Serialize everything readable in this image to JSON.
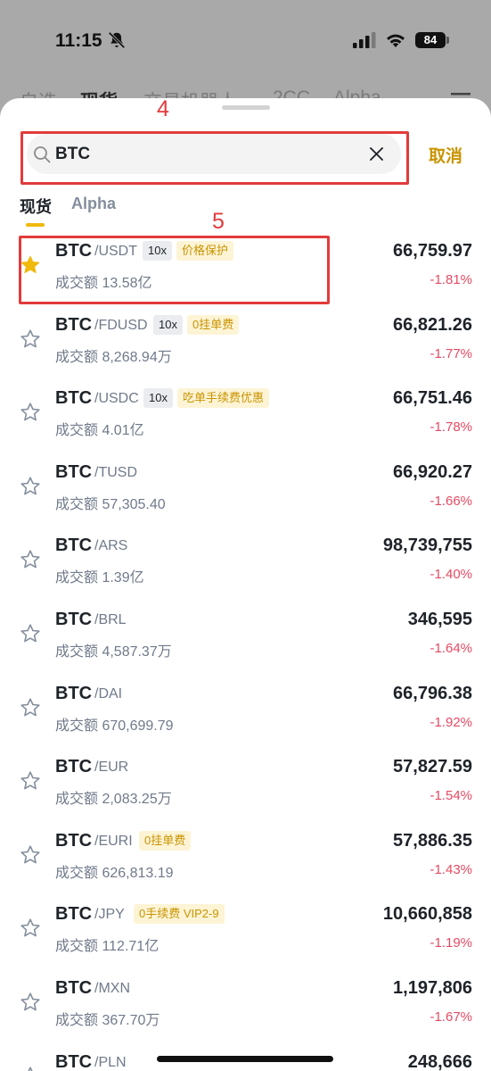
{
  "status_bar": {
    "time": "11:15",
    "battery": "84"
  },
  "background_tabs": [
    "自选",
    "现货",
    "交易机器人",
    "2CC",
    "Alpha"
  ],
  "annotations": {
    "search_marker": "4",
    "row_marker": "5",
    "color": "#e23b3b"
  },
  "search": {
    "value": "BTC",
    "placeholder": "",
    "cancel_label": "取消"
  },
  "tabs": [
    {
      "label": "现货",
      "active": true
    },
    {
      "label": "Alpha",
      "active": false
    }
  ],
  "colors": {
    "accent": "#f0b90b",
    "accent_text": "#c99400",
    "down": "#e54a62"
  },
  "pairs": [
    {
      "base": "BTC",
      "quote": "/USDT",
      "tags": [
        {
          "text": "10x",
          "type": "leverage"
        },
        {
          "text": "价格保护",
          "type": "promo"
        }
      ],
      "volume": "成交额 13.58亿",
      "price": "66,759.97",
      "change": "-1.81%",
      "favorite": true
    },
    {
      "base": "BTC",
      "quote": "/FDUSD",
      "tags": [
        {
          "text": "10x",
          "type": "leverage"
        },
        {
          "text": "0挂单费",
          "type": "promo"
        }
      ],
      "volume": "成交额 8,268.94万",
      "price": "66,821.26",
      "change": "-1.77%",
      "favorite": false
    },
    {
      "base": "BTC",
      "quote": "/USDC",
      "tags": [
        {
          "text": "10x",
          "type": "leverage"
        },
        {
          "text": "吃单手续费优惠",
          "type": "promo"
        }
      ],
      "volume": "成交额 4.01亿",
      "price": "66,751.46",
      "change": "-1.78%",
      "favorite": false
    },
    {
      "base": "BTC",
      "quote": "/TUSD",
      "tags": [],
      "volume": "成交额 57,305.40",
      "price": "66,920.27",
      "change": "-1.66%",
      "favorite": false
    },
    {
      "base": "BTC",
      "quote": "/ARS",
      "tags": [],
      "volume": "成交额 1.39亿",
      "price": "98,739,755",
      "change": "-1.40%",
      "favorite": false
    },
    {
      "base": "BTC",
      "quote": "/BRL",
      "tags": [],
      "volume": "成交额 4,587.37万",
      "price": "346,595",
      "change": "-1.64%",
      "favorite": false
    },
    {
      "base": "BTC",
      "quote": "/DAI",
      "tags": [],
      "volume": "成交额 670,699.79",
      "price": "66,796.38",
      "change": "-1.92%",
      "favorite": false
    },
    {
      "base": "BTC",
      "quote": "/EUR",
      "tags": [],
      "volume": "成交额 2,083.25万",
      "price": "57,827.59",
      "change": "-1.54%",
      "favorite": false
    },
    {
      "base": "BTC",
      "quote": "/EURI",
      "tags": [
        {
          "text": "0挂单费",
          "type": "promo"
        }
      ],
      "volume": "成交额 626,813.19",
      "price": "57,886.35",
      "change": "-1.43%",
      "favorite": false
    },
    {
      "base": "BTC",
      "quote": "/JPY",
      "tags": [
        {
          "text": "0手续费 VIP2-9",
          "type": "promo"
        }
      ],
      "volume": "成交额 112.71亿",
      "price": "10,660,858",
      "change": "-1.19%",
      "favorite": false
    },
    {
      "base": "BTC",
      "quote": "/MXN",
      "tags": [],
      "volume": "成交额 367.70万",
      "price": "1,197,806",
      "change": "-1.67%",
      "favorite": false
    },
    {
      "base": "BTC",
      "quote": "/PLN",
      "tags": [],
      "volume": "",
      "price": "248,666",
      "change": "",
      "favorite": false
    }
  ]
}
